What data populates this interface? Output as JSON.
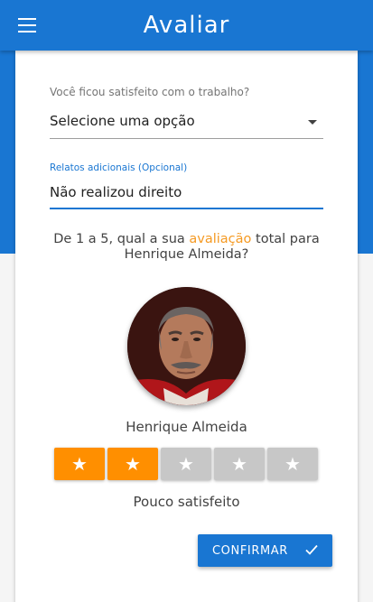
{
  "app_bar": {
    "title": "Avaliar",
    "menu_icon": "menu-icon"
  },
  "form": {
    "satisfaction_label": "Você ficou satisfeito com o trabalho?",
    "satisfaction_value": "Selecione uma opção",
    "additional_label": "Relatos adicionais (Opcional)",
    "additional_value": "Não realizou direito"
  },
  "question": {
    "before": "De 1 a 5, qual a sua ",
    "highlight": "avaliação",
    "after": " total para",
    "name_line": "Henrique Almeida?"
  },
  "worker": {
    "name": "Henrique Almeida"
  },
  "rating": {
    "value": 2,
    "max": 5,
    "label": "Pouco satisfeito",
    "star_glyph": "★"
  },
  "actions": {
    "confirm_label": "CONFIRMAR",
    "confirm_icon": "check-icon"
  },
  "colors": {
    "primary": "#1976d2",
    "accent": "#f59a23",
    "star_active": "#ff8f00",
    "star_inactive": "#c7c7c7"
  }
}
